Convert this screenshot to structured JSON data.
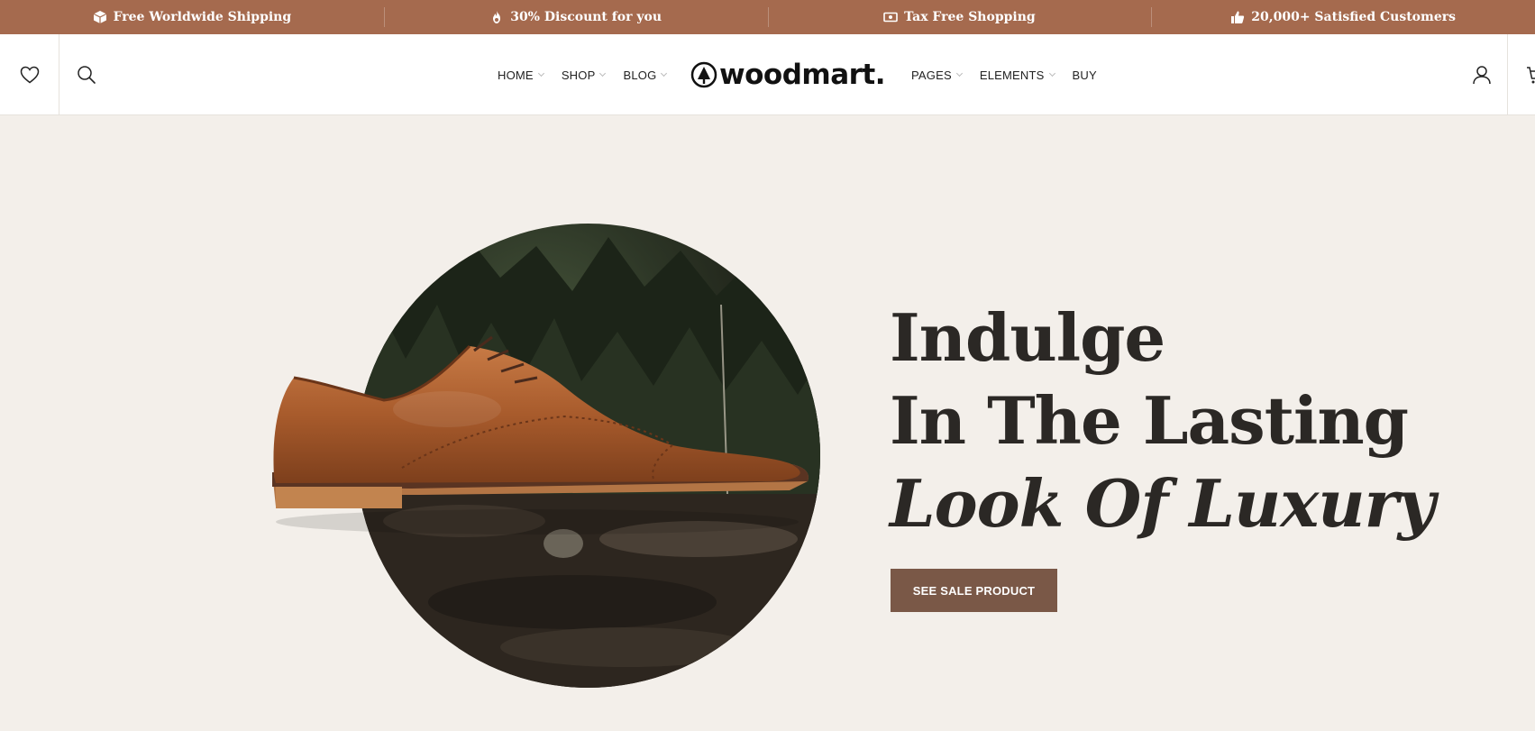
{
  "promo_bar": {
    "items": [
      {
        "icon": "box-icon",
        "text": "Free Worldwide Shipping"
      },
      {
        "icon": "fire-icon",
        "text": "30% Discount for you"
      },
      {
        "icon": "money-icon",
        "text": "Tax Free Shopping"
      },
      {
        "icon": "thumbs-up-icon",
        "text": "20,000+ Satisfied Customers"
      }
    ]
  },
  "header": {
    "logo": "woodmart.",
    "nav_left": [
      {
        "label": "HOME",
        "has_dropdown": true
      },
      {
        "label": "SHOP",
        "has_dropdown": true
      },
      {
        "label": "BLOG",
        "has_dropdown": true
      }
    ],
    "nav_right": [
      {
        "label": "PAGES",
        "has_dropdown": true
      },
      {
        "label": "ELEMENTS",
        "has_dropdown": true
      },
      {
        "label": "BUY",
        "has_dropdown": false
      }
    ],
    "icons": [
      "heart-icon",
      "search-icon",
      "user-icon",
      "cart-icon"
    ]
  },
  "hero": {
    "headline_line1": "Indulge",
    "headline_line2": "In The Lasting",
    "headline_line3": "Look Of Luxury",
    "cta_label": "SEE SALE PRODUCT"
  },
  "colors": {
    "promo_bg": "#a56a4e",
    "hero_bg": "#f3efea",
    "cta_bg": "#7a5847",
    "text_dark": "#2b2825"
  }
}
